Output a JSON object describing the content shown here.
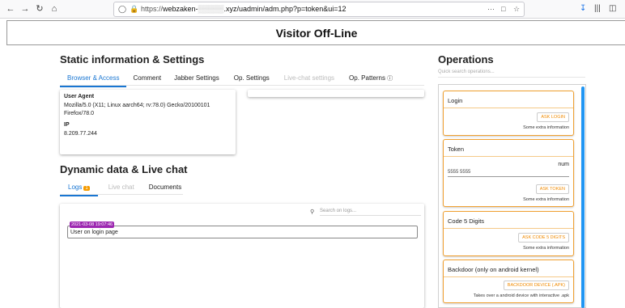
{
  "browser": {
    "url_prefix": "https://",
    "url_host": "webzaken-",
    "url_rest": ".xyz/uadmin/adm.php?p=token&ui=12",
    "dots": "···"
  },
  "header": {
    "title": "Visitor Off-Line"
  },
  "static_section": {
    "heading": "Static information & Settings",
    "tabs": [
      {
        "label": "Browser & Access",
        "state": "active"
      },
      {
        "label": "Comment",
        "state": "normal"
      },
      {
        "label": "Jabber Settings",
        "state": "normal"
      },
      {
        "label": "Op. Settings",
        "state": "normal"
      },
      {
        "label": "Live-chat settings",
        "state": "disabled"
      },
      {
        "label": "Op. Patterns",
        "state": "normal"
      }
    ],
    "user_agent_label": "User Agent",
    "user_agent_line1": "Mozilla/5.0 (X11; Linux aarch64; rv:78.0) Gecko/20100101",
    "user_agent_line2": "Firefox/78.0",
    "ip_label": "IP",
    "ip_value": "8.209.77.244"
  },
  "dynamic_section": {
    "heading": "Dynamic data & Live chat",
    "tabs": [
      {
        "label": "Logs",
        "badge": "1",
        "state": "active"
      },
      {
        "label": "Live chat",
        "state": "disabled"
      },
      {
        "label": "Documents",
        "state": "normal"
      }
    ],
    "search_placeholder": "Search on logs...",
    "log": {
      "time": "2021-03-08 19:07:46",
      "text": "User on login page"
    }
  },
  "operations": {
    "heading": "Operations",
    "search_placeholder": "Quick search operations...",
    "cards": [
      {
        "title": "Login",
        "button": "ASK LOGIN",
        "extra": "Some extra information"
      },
      {
        "title": "Token",
        "field_label": "num",
        "field_value": "5555 5555",
        "button": "ASK TOKEN",
        "extra": "Some extra information"
      },
      {
        "title": "Code 5 Digits",
        "button": "ASK CODE 5 DIGITS",
        "extra": "Some extra information"
      },
      {
        "title": "Backdoor (only on android kernel)",
        "button": "BACKDOOR DEVICE (.APK)",
        "extra": "Takes over a android device with interactive .apk"
      }
    ]
  },
  "colors": {
    "accent": "#1976d2",
    "warning": "#f08a00",
    "badge": "#f59b00",
    "timestamp": "#9c27b0",
    "scroll": "#2196f3"
  }
}
